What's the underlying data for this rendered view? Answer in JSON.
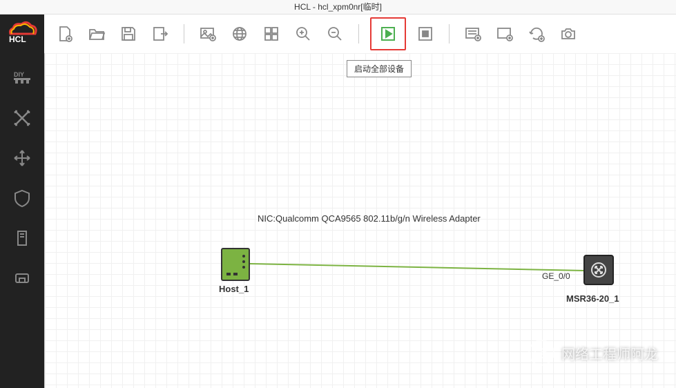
{
  "titlebar": {
    "title": "HCL - hcl_xpm0nr[临时]"
  },
  "toolbar": {
    "tooltip_start_all": "启动全部设备"
  },
  "canvas": {
    "nic_label": "NIC:Qualcomm QCA9565 802.11b/g/n Wireless Adapter",
    "host": {
      "label": "Host_1"
    },
    "router": {
      "label": "MSR36-20_1",
      "port_label": "GE_0/0"
    }
  },
  "watermark": {
    "text": "网络工程师阿龙"
  },
  "sidebar": {
    "items": [
      "diy",
      "topology",
      "move",
      "security",
      "server",
      "port"
    ]
  }
}
